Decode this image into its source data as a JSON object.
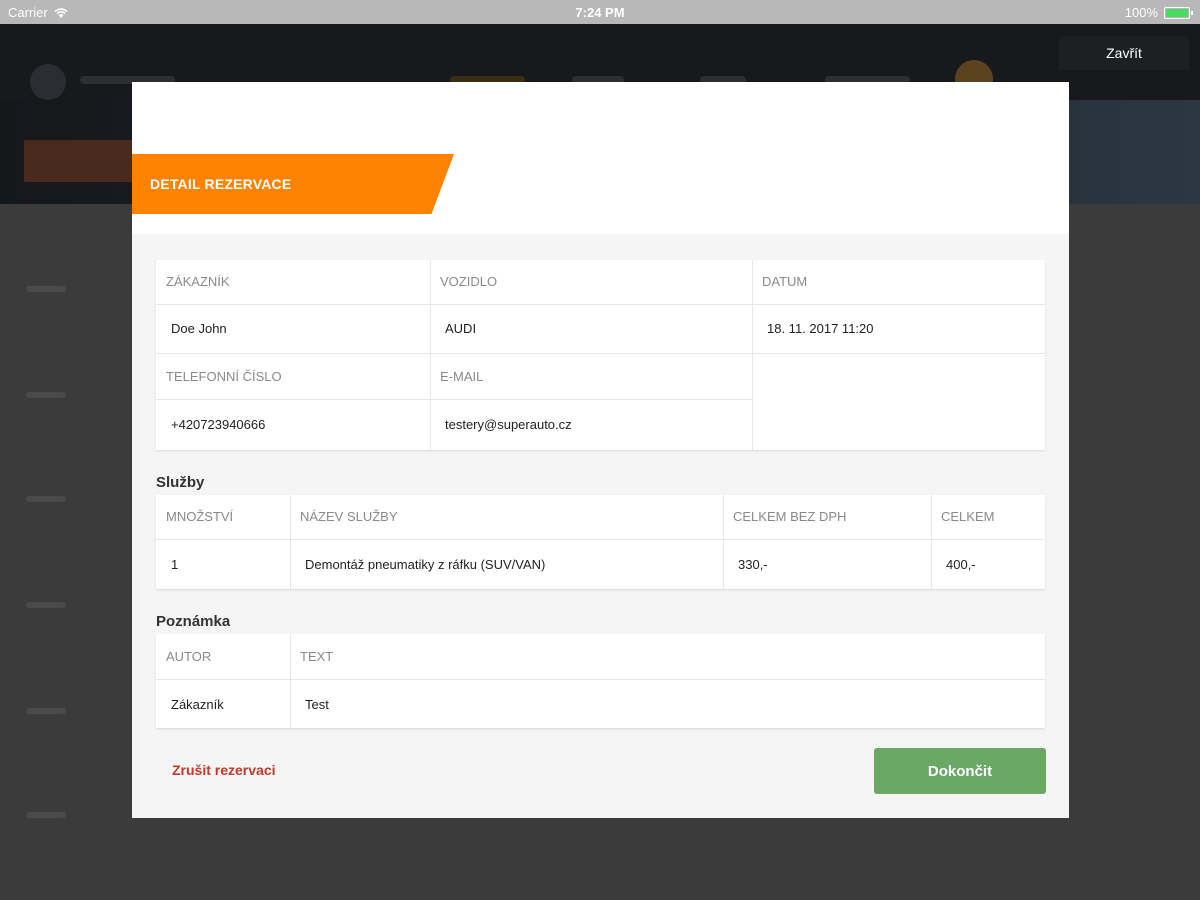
{
  "status_bar": {
    "carrier": "Carrier",
    "time": "7:24 PM",
    "battery": "100%",
    "battery_color": "#4cd964"
  },
  "top_close_label": "Zavřít",
  "modal": {
    "title": "DETAIL REZERVACE",
    "accent_color": "#ff8200",
    "customer_table": {
      "customer_header": "ZÁKAZNÍK",
      "customer_value": "Doe John",
      "vehicle_header": "VOZIDLO",
      "vehicle_value": "AUDI",
      "date_header": "DATUM",
      "date_value": "18. 11. 2017 11:20",
      "phone_header": "TELEFONNÍ ČÍSLO",
      "phone_value": "+420723940666",
      "email_header": "E-MAIL",
      "email_value": "testery@superauto.cz"
    },
    "services": {
      "title": "Služby",
      "headers": [
        "MNOŽSTVÍ",
        "NÁZEV SLUŽBY",
        "CELKEM BEZ DPH",
        "CELKEM"
      ],
      "rows": [
        [
          "1",
          "Demontáž pneumatiky z ráfku (SUV/VAN)",
          "330,-",
          "400,-"
        ]
      ]
    },
    "note": {
      "title": "Poznámka",
      "headers": [
        "AUTOR",
        "TEXT"
      ],
      "rows": [
        [
          "Zákazník",
          "Test"
        ]
      ]
    },
    "cancel_label": "Zrušit rezervaci",
    "finish_label": "Dokončit",
    "finish_color": "#6aa865"
  }
}
